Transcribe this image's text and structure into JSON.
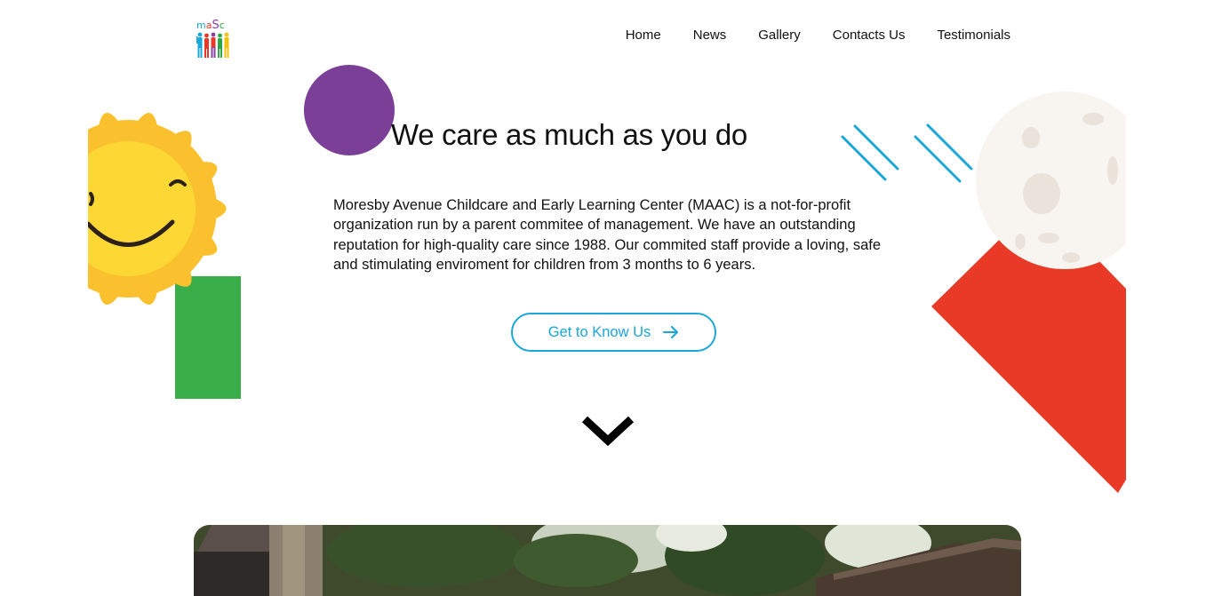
{
  "brand": {
    "logo_text": [
      "m",
      "a",
      "S",
      "c"
    ],
    "logo_colors": [
      "#1aa7d9",
      "#e53a2a",
      "#8a3fa0",
      "#2ba84a",
      "#f2c20c"
    ]
  },
  "nav": {
    "items": [
      "Home",
      "News",
      "Gallery",
      "Contacts Us",
      "Testimonials"
    ]
  },
  "hero": {
    "title": "We care as much as you do",
    "description": "Moresby Avenue Childcare and Early Learning Center (MAAC) is a not-for-profit organization run by a parent commitee of management. We have an outstanding reputation for high-quality care since 1988. Our commited staff provide a loving, safe and stimulating enviroment for children from 3 months to 6 years.",
    "cta_label": "Get to Know Us",
    "cta_icon": "arrow-right-icon",
    "scroll_icon": "chevron-down-icon"
  },
  "colors": {
    "purple": "#7b3f98",
    "accent_blue": "#1aa7d9",
    "sun_yellow": "#fbc02d",
    "sun_face": "#fdd835",
    "green": "#3aae48",
    "red": "#e83a27",
    "moon": "#f8f5f1"
  }
}
